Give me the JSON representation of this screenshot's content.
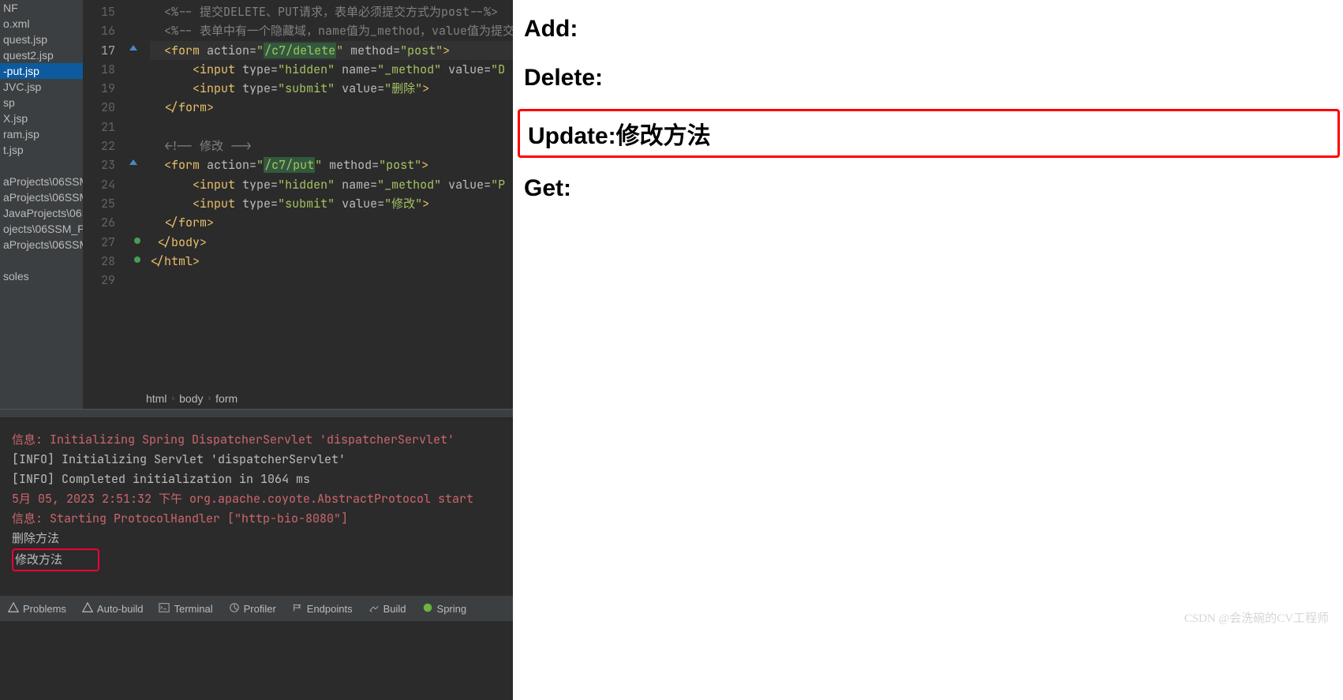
{
  "sidebar": {
    "items": [
      "NF",
      "o.xml",
      "quest.jsp",
      "quest2.jsp",
      "-put.jsp",
      "JVC.jsp",
      "sp",
      "X.jsp",
      "ram.jsp",
      "t.jsp"
    ],
    "selectedIndex": 4,
    "paths": [
      "aProjects\\06SSM",
      "aProjects\\06SSM",
      "JavaProjects\\06SS",
      "ojects\\06SSM_Pr",
      "aProjects\\06SSM"
    ],
    "soles": "soles"
  },
  "editor": {
    "lineStart": 15,
    "lines": [
      {
        "n": 15,
        "seg": [
          {
            "c": "t-cmt",
            "t": "<%-- "
          },
          {
            "c": "t-cmtc",
            "t": "提交DELETE、PUT请求，表单必须提交方式为post"
          },
          {
            "c": "t-cmt",
            "t": "--%>"
          }
        ]
      },
      {
        "n": 16,
        "seg": [
          {
            "c": "t-cmt",
            "t": "<%-- "
          },
          {
            "c": "t-cmtc",
            "t": "表单中有一个隐藏域，name值为_method，value值为提交"
          }
        ],
        "cut": true
      },
      {
        "n": 17,
        "caret": true,
        "mark": "up",
        "seg": [
          {
            "c": "t-tag",
            "t": "<form "
          },
          {
            "c": "t-attr",
            "t": "action="
          },
          {
            "c": "t-val",
            "t": "\""
          },
          {
            "c": "hlbg",
            "t": "/c7/delete"
          },
          {
            "c": "t-val",
            "t": "\" "
          },
          {
            "c": "t-attr",
            "t": "method="
          },
          {
            "c": "t-val",
            "t": "\"post\""
          },
          {
            "c": "t-tag",
            "t": ">"
          }
        ]
      },
      {
        "n": 18,
        "seg": [
          {
            "c": "",
            "t": "    "
          },
          {
            "c": "t-tag",
            "t": "<input "
          },
          {
            "c": "t-attr",
            "t": "type="
          },
          {
            "c": "t-val",
            "t": "\"hidden\" "
          },
          {
            "c": "t-attr",
            "t": "name="
          },
          {
            "c": "t-val",
            "t": "\"_method\" "
          },
          {
            "c": "t-attr",
            "t": "value="
          },
          {
            "c": "t-val",
            "t": "\"D"
          }
        ],
        "cut": true
      },
      {
        "n": 19,
        "seg": [
          {
            "c": "",
            "t": "    "
          },
          {
            "c": "t-tag",
            "t": "<input "
          },
          {
            "c": "t-attr",
            "t": "type="
          },
          {
            "c": "t-val",
            "t": "\"submit\" "
          },
          {
            "c": "t-attr",
            "t": "value="
          },
          {
            "c": "t-val",
            "t": "\"删除\""
          },
          {
            "c": "t-tag",
            "t": ">"
          }
        ]
      },
      {
        "n": 20,
        "seg": [
          {
            "c": "t-tag",
            "t": "</form>"
          }
        ]
      },
      {
        "n": 21,
        "seg": []
      },
      {
        "n": 22,
        "seg": [
          {
            "c": "t-cmt",
            "t": "<!-- "
          },
          {
            "c": "t-cmtc",
            "t": "修改"
          },
          {
            "c": "t-cmt",
            "t": " -->"
          }
        ]
      },
      {
        "n": 23,
        "mark": "up",
        "seg": [
          {
            "c": "t-tag",
            "t": "<form "
          },
          {
            "c": "t-attr",
            "t": "action="
          },
          {
            "c": "t-val",
            "t": "\""
          },
          {
            "c": "hlbg",
            "t": "/c7/put"
          },
          {
            "c": "t-val",
            "t": "\" "
          },
          {
            "c": "t-attr",
            "t": "method="
          },
          {
            "c": "t-val",
            "t": "\"post\""
          },
          {
            "c": "t-tag",
            "t": ">"
          }
        ]
      },
      {
        "n": 24,
        "seg": [
          {
            "c": "",
            "t": "    "
          },
          {
            "c": "t-tag",
            "t": "<input "
          },
          {
            "c": "t-attr",
            "t": "type="
          },
          {
            "c": "t-val",
            "t": "\"hidden\" "
          },
          {
            "c": "t-attr",
            "t": "name="
          },
          {
            "c": "t-val",
            "t": "\"_method\" "
          },
          {
            "c": "t-attr",
            "t": "value="
          },
          {
            "c": "t-val",
            "t": "\"P"
          }
        ],
        "cut": true
      },
      {
        "n": 25,
        "seg": [
          {
            "c": "",
            "t": "    "
          },
          {
            "c": "t-tag",
            "t": "<input "
          },
          {
            "c": "t-attr",
            "t": "type="
          },
          {
            "c": "t-val",
            "t": "\"submit\" "
          },
          {
            "c": "t-attr",
            "t": "value="
          },
          {
            "c": "t-val",
            "t": "\"修改\""
          },
          {
            "c": "t-tag",
            "t": ">"
          }
        ]
      },
      {
        "n": 26,
        "seg": [
          {
            "c": "t-tag",
            "t": "</form>"
          }
        ]
      },
      {
        "n": 27,
        "mark": "dot",
        "ind": -1,
        "seg": [
          {
            "c": "t-tag",
            "t": "</body>"
          }
        ]
      },
      {
        "n": 28,
        "mark": "dot",
        "ind": -2,
        "seg": [
          {
            "c": "t-tag",
            "t": "</html>"
          }
        ]
      },
      {
        "n": 29,
        "seg": []
      }
    ],
    "breadcrumb": [
      "html",
      "body",
      "form"
    ]
  },
  "console": {
    "lines": [
      {
        "c": "red",
        "t": "信息: Initializing Spring DispatcherServlet 'dispatcherServlet'"
      },
      {
        "c": "norm",
        "t": "[INFO] Initializing Servlet 'dispatcherServlet'"
      },
      {
        "c": "norm",
        "t": "[INFO] Completed initialization in 1064 ms"
      },
      {
        "c": "red",
        "t": "5月 05, 2023 2:51:32 下午 org.apache.coyote.AbstractProtocol start"
      },
      {
        "c": "red",
        "t": "信息: Starting ProtocolHandler [\"http-bio-8080\"]"
      },
      {
        "c": "norm",
        "t": "删除方法"
      },
      {
        "c": "boxed",
        "t": "修改方法"
      }
    ]
  },
  "bottombar": {
    "items": [
      {
        "icon": "warning",
        "label": "Problems"
      },
      {
        "icon": "warning",
        "label": "Auto-build"
      },
      {
        "icon": "terminal",
        "label": "Terminal"
      },
      {
        "icon": "profiler",
        "label": "Profiler"
      },
      {
        "icon": "endpoints",
        "label": "Endpoints"
      },
      {
        "icon": "build",
        "label": "Build"
      },
      {
        "icon": "spring",
        "label": "Spring"
      }
    ]
  },
  "browser": {
    "results": [
      {
        "label": "Add:",
        "highlighted": false
      },
      {
        "label": "Delete:",
        "highlighted": false
      },
      {
        "label": "Update:修改方法",
        "highlighted": true
      },
      {
        "label": "Get:",
        "highlighted": false
      }
    ]
  },
  "watermark": "CSDN @会洗碗的CV工程师"
}
